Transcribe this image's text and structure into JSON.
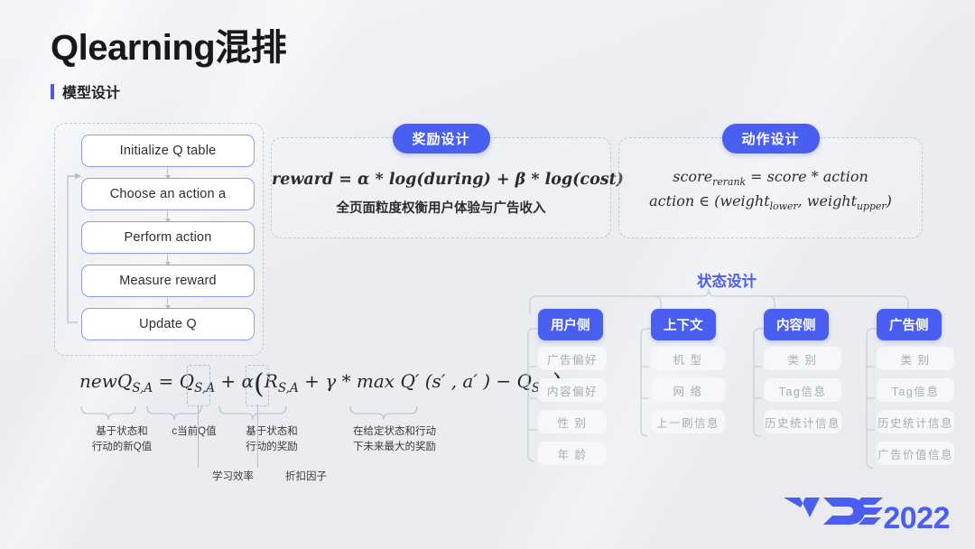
{
  "header": {
    "title": "Qlearning混排",
    "subtitle": "模型设计"
  },
  "flowchart": {
    "steps": [
      "Initialize Q table",
      "Choose an action a",
      "Perform action",
      "Measure reward",
      "Update Q"
    ]
  },
  "reward_card": {
    "badge": "奖励设计",
    "formula": "reward = α * log(during) + β * log(cost)",
    "caption": "全页面粒度权衡用户体验与广告收入"
  },
  "action_card": {
    "badge": "动作设计",
    "formula_score": "score",
    "formula_score_sub": "rerank",
    "formula_score_rest": " = score  * action",
    "formula_action_prefix": "action ∈ (weight",
    "formula_action_sub1": "lower",
    "formula_action_mid": ", weight",
    "formula_action_sub2": "upper",
    "formula_action_suffix": ")"
  },
  "q_formula": {
    "lhs": "newQ",
    "lhs_sub": "S,A",
    "eq": " = Q",
    "q_sub": "S,A",
    "plus_alpha": " + α",
    "open": "(",
    "r": "R",
    "r_sub": "S,A",
    "gamma_part": " + γ * max Q′ (s′ , a′ ) − Q",
    "last_sub": "S,A",
    "close": ")",
    "annotations": {
      "new_q": "基于状态和\n行动的新Q值",
      "current_q": "c当前Q值",
      "reward": "基于状态和\n行动的奖励",
      "future_max": "在给定状态和行动\n下未来最大的奖励",
      "learning_rate": "学习效率",
      "discount": "折扣因子"
    }
  },
  "state_design": {
    "title": "状态设计",
    "columns": [
      {
        "head": "用户侧",
        "items": [
          "广告偏好",
          "内容偏好",
          "性 别",
          "年 龄"
        ]
      },
      {
        "head": "上下文",
        "items": [
          "机 型",
          "网 络",
          "上一刷信息"
        ]
      },
      {
        "head": "内容侧",
        "items": [
          "类 别",
          "Tag信息",
          "历史统计信息"
        ]
      },
      {
        "head": "广告侧",
        "items": [
          "类 别",
          "Tag信息",
          "历史统计信息",
          "广告价值信息"
        ]
      }
    ]
  },
  "logo": {
    "mark": "VDC",
    "year": "2022"
  },
  "colors": {
    "accent": "#4a5ef2",
    "background": "#eceef3",
    "box_border": "#8d9cf2",
    "leaf_bg": "#f6f7fa",
    "leaf_text": "#a9acb6",
    "dash_border": "#c3c7d0"
  }
}
